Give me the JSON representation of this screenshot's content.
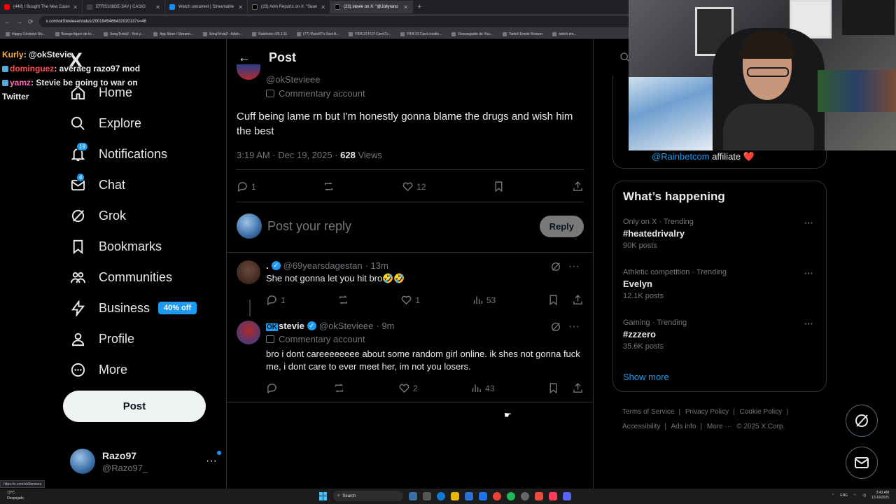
{
  "browser": {
    "tabs": [
      {
        "title": "(448) I Bought The New Casio",
        "color": "#ff0000"
      },
      {
        "title": "EFRS108DE-3AV | CASIO",
        "color": "#3c4043"
      },
      {
        "title": "Watch unnamed | Streamable",
        "color": "#0f90fa"
      },
      {
        "title": "(23) Adin Reports on X: \"Sean",
        "color": "#000000"
      },
      {
        "title": "(23) stevie on X: \"@Jollyrano",
        "color": "#000000"
      }
    ],
    "new_tab": "+",
    "url": "x.com/okStevieee/status/2001945466432020137s=46",
    "bookmarks": [
      "Happy Cristiano Ro...",
      "Burego figure de to...",
      "SongTrivia2 - Test y...",
      "App Store / Streami...",
      "SongTrivia2 - Advin...",
      "Raletools v25.1.11",
      "(77) Razo97's Zest-A...",
      "FIFA 23 FUT Card Cr...",
      "FIFA 23 Card creatio...",
      "Descargador de You...",
      "Twitch Emote Resizer",
      "twitch em..."
    ],
    "status_url": "https://x.com/okStevieee"
  },
  "chat_overlay": [
    {
      "user": "Kurly",
      "color": "#ffb347",
      "text": ": @okStevie"
    },
    {
      "user": "dominguez",
      "color": "#ff4d4d",
      "text": ": averaeg razo97 mod"
    },
    {
      "user": "yamz",
      "color": "#ff69b4",
      "text": ": Stevie be going to war on Twitter"
    }
  ],
  "nav": {
    "logo": "X",
    "items": [
      {
        "label": "Home",
        "icon": "home-icon"
      },
      {
        "label": "Explore",
        "icon": "search-icon"
      },
      {
        "label": "Notifications",
        "icon": "bell-icon",
        "badge": "19"
      },
      {
        "label": "Chat",
        "icon": "mail-icon",
        "badge": "4"
      },
      {
        "label": "Grok",
        "icon": "grok-icon"
      },
      {
        "label": "Bookmarks",
        "icon": "bookmark-icon"
      },
      {
        "label": "Communities",
        "icon": "communities-icon"
      },
      {
        "label": "Business",
        "icon": "lightning-icon",
        "pill": "40% off"
      },
      {
        "label": "Profile",
        "icon": "person-icon"
      },
      {
        "label": "More",
        "icon": "more-circle-icon"
      }
    ],
    "post_button": "Post",
    "account": {
      "name": "Razo97",
      "handle": "@Razo97_",
      "more": "···"
    }
  },
  "main": {
    "header_title": "Post",
    "post": {
      "handle": "@okStevieee",
      "label": "Commentary account",
      "text": "Cuff being lame rn but I'm honestly gonna blame the drugs and wish him the best",
      "timestamp": "3:19 AM · Dec 19, 2025 · ",
      "views_count": "628",
      "views_label": " Views",
      "replies": "1",
      "likes": "12"
    },
    "reply_box": {
      "placeholder": "Post your reply",
      "button": "Reply"
    },
    "replies": [
      {
        "name": ".",
        "handle": "@69yearsdagestan",
        "time": "· 13m",
        "text": "She not gonna let you hit bro🤣🤣",
        "replies": "1",
        "likes": "1",
        "views": "53"
      },
      {
        "name_prefix": "OK",
        "name": "stevie",
        "handle": "@okStevieee",
        "time": "· 9m",
        "label": "Commentary account",
        "text": "bro i dont careeeeeeee about some random girl online. ik shes not gonna fuck me, i dont care to ever meet her, im not you losers.",
        "replies": "",
        "likes": "2",
        "views": "43"
      }
    ]
  },
  "right": {
    "affiliate_link": "@Rainbetcom",
    "affiliate_text": " affiliate",
    "heart": "❤️",
    "happening_title": "What’s happening",
    "trends": [
      {
        "context": "Only on X · Trending",
        "name": "#heatedrivalry",
        "count": "90K posts"
      },
      {
        "context": "Athletic competition · Trending",
        "name": "Evelyn",
        "count": "12.1K posts"
      },
      {
        "context": "Gaming · Trending",
        "name": "#zzzero",
        "count": "35.6K posts"
      }
    ],
    "show_more": "Show more",
    "footer": [
      "Terms of Service",
      "Privacy Policy",
      "Cookie Policy",
      "Accessibility",
      "Ads info",
      "More ···",
      "© 2025 X Corp."
    ]
  },
  "taskbar": {
    "weather_temp": "13°C",
    "weather_desc": "Despejado",
    "search": "Search",
    "lang": "ENG",
    "time": "3:43 AM",
    "date": "12/19/2025"
  }
}
